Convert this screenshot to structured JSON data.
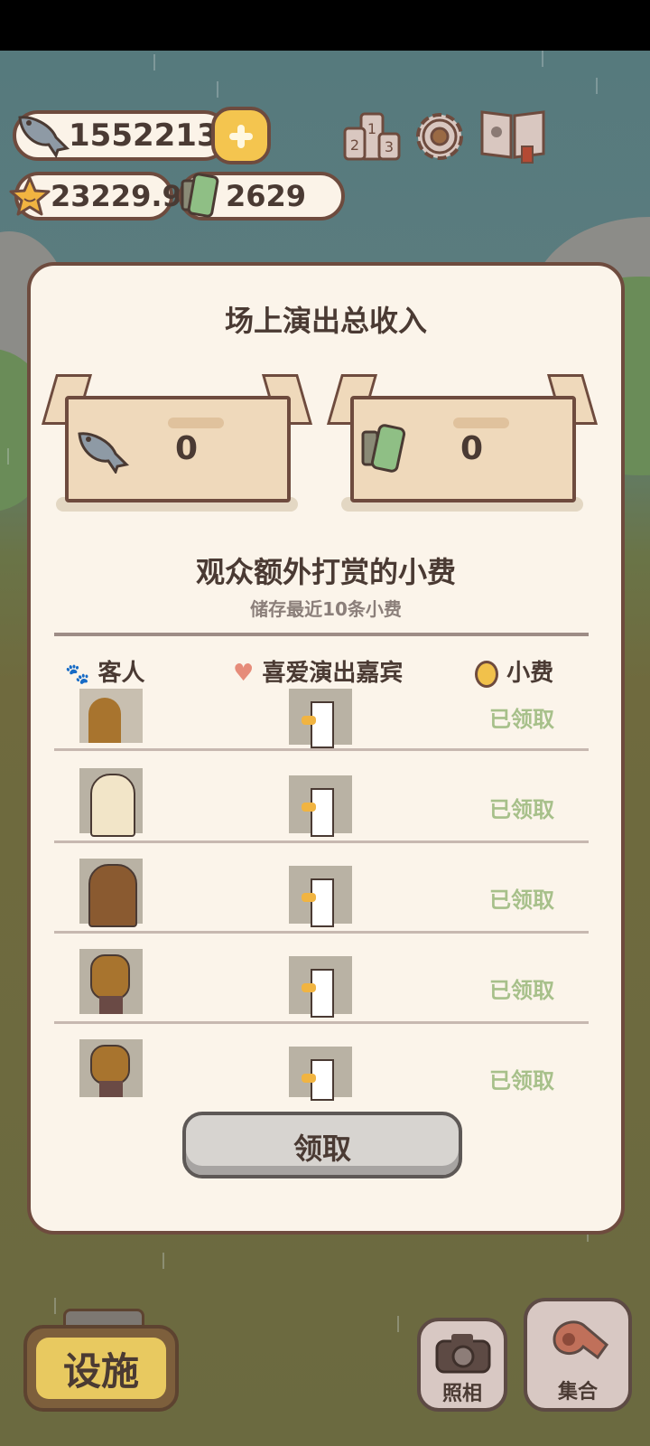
{
  "hud": {
    "fish": "1552213",
    "stars": "23229.9",
    "film": "2629"
  },
  "modal": {
    "title": "场上演出总收入",
    "fish_income": "0",
    "film_income": "0",
    "tips_title": "观众额外打赏的小费",
    "tips_subtitle": "储存最近10条小费",
    "columns": {
      "guest": "客人",
      "performer": "喜爱演出嘉宾",
      "tip": "小费"
    },
    "rows": [
      {
        "guest": "hedgehog",
        "performer": "chicken",
        "status": "已领取"
      },
      {
        "guest": "penguin",
        "performer": "chicken",
        "status": "已领取"
      },
      {
        "guest": "bear",
        "performer": "chicken",
        "status": "已领取"
      },
      {
        "guest": "dog",
        "performer": "chicken",
        "status": "已领取"
      },
      {
        "guest": "dog",
        "performer": "chicken",
        "status": "已领取"
      }
    ],
    "claim_label": "领取"
  },
  "bottom": {
    "facility_label": "设施",
    "photo_label": "照相",
    "gather_label": "集合"
  },
  "colors": {
    "panel_bg": "#fbf4ea",
    "border": "#6e4b3e",
    "claimed_text": "#a7c08a",
    "box": "#efd9bb"
  }
}
